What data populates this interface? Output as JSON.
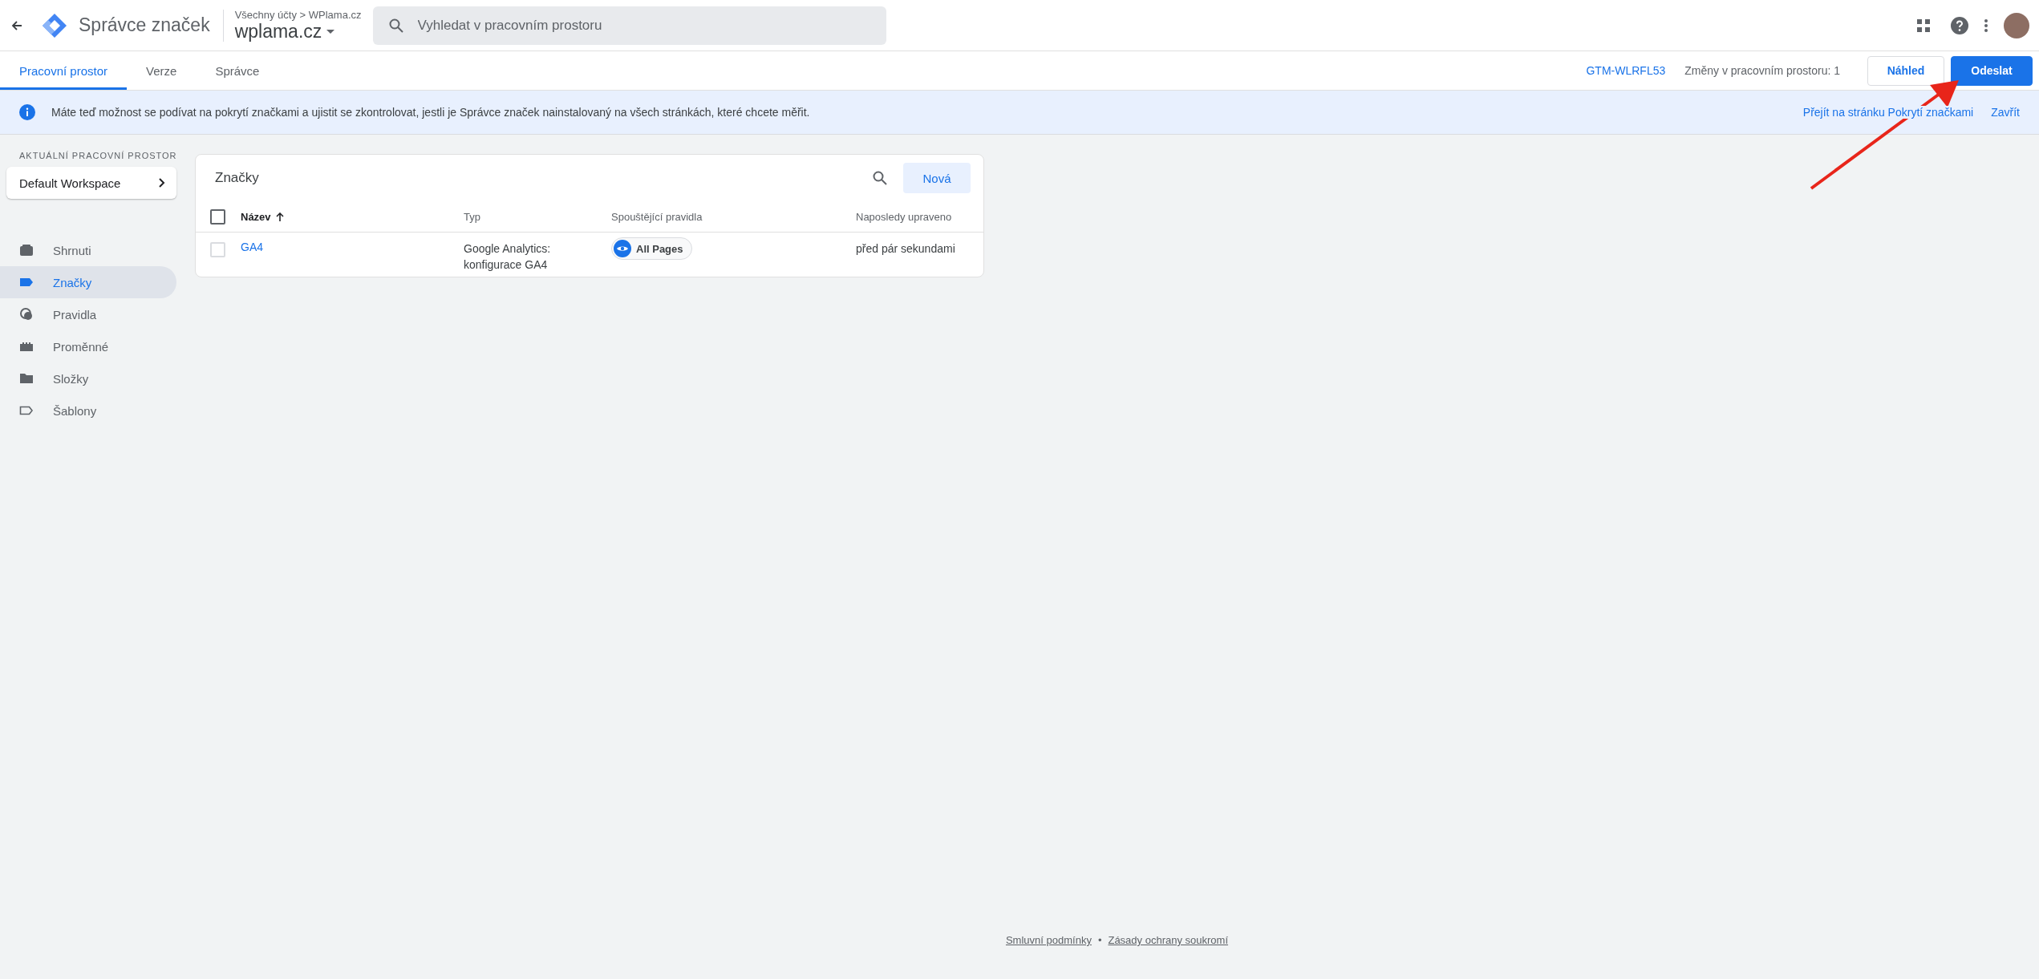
{
  "header": {
    "product": "Správce značek",
    "breadcrumb": "Všechny účty > WPlama.cz",
    "account": "wplama.cz",
    "search": {
      "placeholder": "Vyhledat v pracovním prostoru"
    }
  },
  "tabs": [
    {
      "label": "Pracovní prostor",
      "selected": true
    },
    {
      "label": "Verze",
      "selected": false
    },
    {
      "label": "Správce",
      "selected": false
    }
  ],
  "container_id": "GTM-WLRFL53",
  "changes": "Změny v pracovním prostoru: 1",
  "buttons": [
    {
      "label": "Náhled",
      "kind": "outlined"
    },
    {
      "label": "Odeslat",
      "kind": "primary"
    }
  ],
  "banner": {
    "message": "Máte teď možnost se podívat na pokrytí značkami a ujistit se zkontrolovat, jestli je Správce značek nainstalovaný na všech stránkách, které chcete měřit.",
    "links": [
      "Přejít na stránku Pokrytí značkami",
      "Zavřít"
    ]
  },
  "sidebar": {
    "section_label": "AKTUÁLNÍ PRACOVNÍ PROSTOR",
    "workspace": "Default Workspace",
    "items": [
      {
        "label": "Shrnuti",
        "kind": "summary",
        "selected": false
      },
      {
        "label": "Značky",
        "kind": "tags",
        "selected": true
      },
      {
        "label": "Pravidla",
        "kind": "triggers",
        "selected": false
      },
      {
        "label": "Proměnné",
        "kind": "variables",
        "selected": false
      },
      {
        "label": "Složky",
        "kind": "folders",
        "selected": false
      },
      {
        "label": "Šablony",
        "kind": "templates",
        "selected": false
      }
    ]
  },
  "tags_card": {
    "title": "Značky",
    "new_button": "Nová",
    "header_checked": false,
    "columns": [
      {
        "label": "Název",
        "sorted": true
      },
      {
        "label": "Typ",
        "sorted": false
      },
      {
        "label": "Spouštějící pravidla",
        "sorted": false
      },
      {
        "label": "Naposledy upraveno",
        "sorted": false
      }
    ],
    "rows": [
      {
        "name": "GA4",
        "type": "Google Analytics: konfigurace GA4",
        "trigger": "All Pages",
        "modified": "před pár sekundami",
        "checked": false
      }
    ]
  },
  "footer": {
    "links": [
      "Smluvní podmínky",
      "Zásady ochrany soukromí"
    ],
    "separator": "•"
  }
}
